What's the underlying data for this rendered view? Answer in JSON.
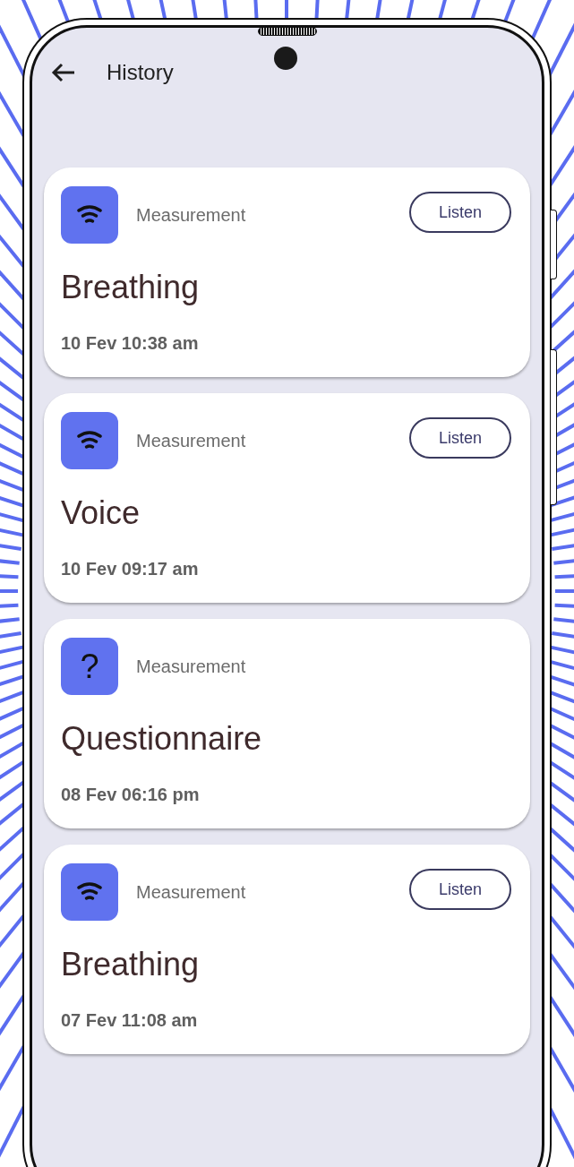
{
  "header": {
    "title": "History"
  },
  "entries": [
    {
      "kind": "wave",
      "label": "Measurement",
      "title": "Breathing",
      "date": "10 Fev 10:38 am",
      "action": "Listen"
    },
    {
      "kind": "wave",
      "label": "Measurement",
      "title": "Voice",
      "date": "10 Fev 09:17 am",
      "action": "Listen"
    },
    {
      "kind": "question",
      "icon": "?",
      "label": "Measurement",
      "title": "Questionnaire",
      "date": "08 Fev 06:16 pm"
    },
    {
      "kind": "wave",
      "label": "Measurement",
      "title": "Breathing",
      "date": "07 Fev 11:08 am",
      "action": "Listen"
    }
  ]
}
